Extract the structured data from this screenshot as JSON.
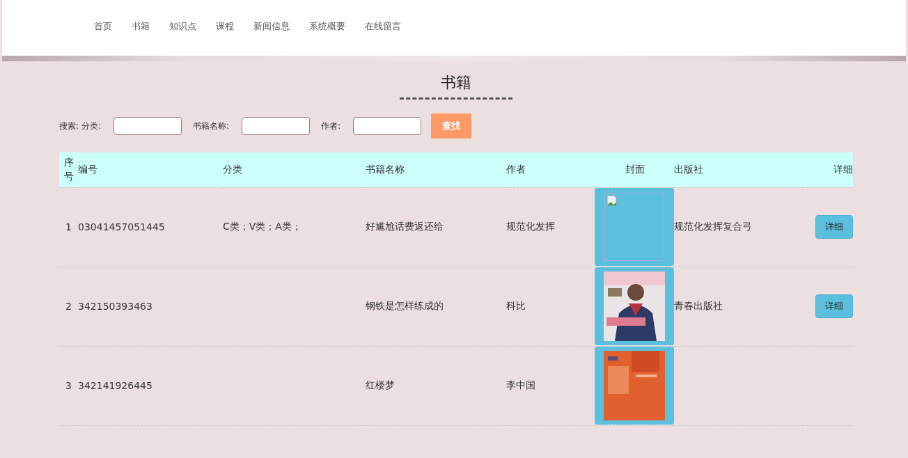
{
  "nav": [
    "首页",
    "书籍",
    "知识点",
    "课程",
    "新闻信息",
    "系统概要",
    "在线留言"
  ],
  "title": "书籍",
  "search": {
    "label": "搜索:",
    "fields": [
      {
        "label": "分类:"
      },
      {
        "label": "书籍名称:"
      },
      {
        "label": "作者:"
      }
    ],
    "button": "查找"
  },
  "table": {
    "columns": [
      "序号",
      "编号",
      "分类",
      "书籍名称",
      "作者",
      "封面",
      "出版社",
      "详细"
    ],
    "rows": [
      {
        "index": "1",
        "code": "03041457051445",
        "category": "C类；V类；A类；",
        "name": "好尴尬话费返还给",
        "author": "规范化发挥",
        "cover": {
          "kind": "broken"
        },
        "publisher": "规范化发挥复合弓",
        "button": "详细"
      },
      {
        "index": "2",
        "code": "342150393463",
        "name": "钢铁是怎样练成的",
        "author": "科比",
        "publisher": "青春出版社",
        "button": "详细"
      },
      {
        "index": "3",
        "code": "342141926445",
        "name": "红楼梦",
        "author": "李中国"
      }
    ]
  }
}
